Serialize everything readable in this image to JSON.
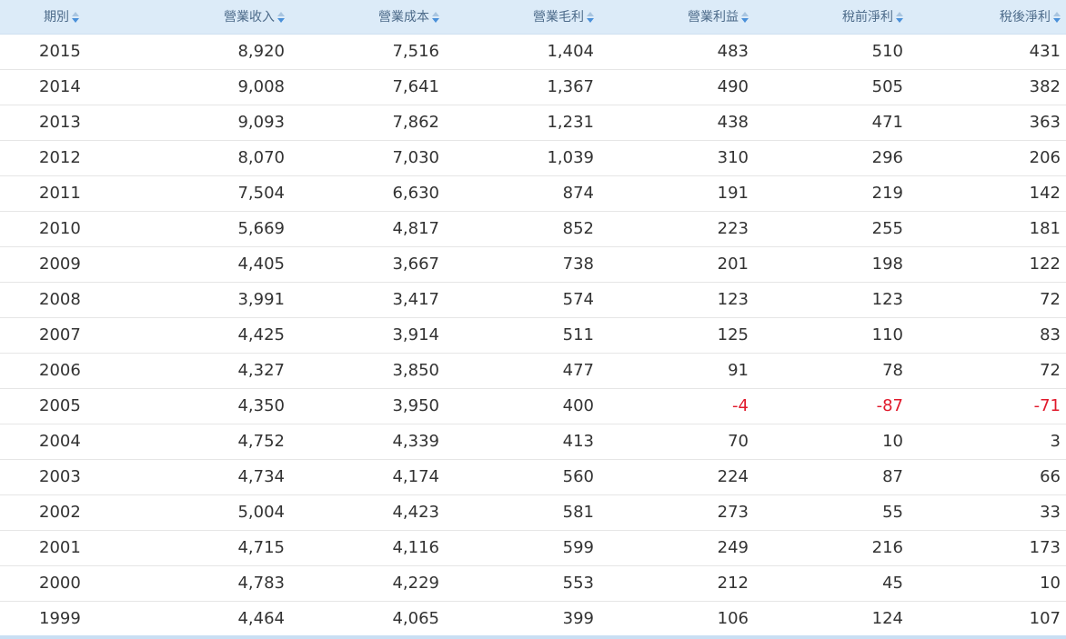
{
  "table": {
    "headers": [
      "期別",
      "營業收入",
      "營業成本",
      "營業毛利",
      "營業利益",
      "稅前淨利",
      "稅後淨利"
    ],
    "rows": [
      [
        "2015",
        "8,920",
        "7,516",
        "1,404",
        "483",
        "510",
        "431"
      ],
      [
        "2014",
        "9,008",
        "7,641",
        "1,367",
        "490",
        "505",
        "382"
      ],
      [
        "2013",
        "9,093",
        "7,862",
        "1,231",
        "438",
        "471",
        "363"
      ],
      [
        "2012",
        "8,070",
        "7,030",
        "1,039",
        "310",
        "296",
        "206"
      ],
      [
        "2011",
        "7,504",
        "6,630",
        "874",
        "191",
        "219",
        "142"
      ],
      [
        "2010",
        "5,669",
        "4,817",
        "852",
        "223",
        "255",
        "181"
      ],
      [
        "2009",
        "4,405",
        "3,667",
        "738",
        "201",
        "198",
        "122"
      ],
      [
        "2008",
        "3,991",
        "3,417",
        "574",
        "123",
        "123",
        "72"
      ],
      [
        "2007",
        "4,425",
        "3,914",
        "511",
        "125",
        "110",
        "83"
      ],
      [
        "2006",
        "4,327",
        "3,850",
        "477",
        "91",
        "78",
        "72"
      ],
      [
        "2005",
        "4,350",
        "3,950",
        "400",
        "-4",
        "-87",
        "-71"
      ],
      [
        "2004",
        "4,752",
        "4,339",
        "413",
        "70",
        "10",
        "3"
      ],
      [
        "2003",
        "4,734",
        "4,174",
        "560",
        "224",
        "87",
        "66"
      ],
      [
        "2002",
        "5,004",
        "4,423",
        "581",
        "273",
        "55",
        "33"
      ],
      [
        "2001",
        "4,715",
        "4,116",
        "599",
        "249",
        "216",
        "173"
      ],
      [
        "2000",
        "4,783",
        "4,229",
        "553",
        "212",
        "45",
        "10"
      ],
      [
        "1999",
        "4,464",
        "4,065",
        "399",
        "106",
        "124",
        "107"
      ]
    ]
  },
  "colors": {
    "header_bg": "#dcebf8",
    "header_text": "#4d6b8a",
    "cell_text": "#333333",
    "negative_text": "#e0192b",
    "sort_arrow_active": "#4a90d9"
  },
  "icons": {
    "sort": "sort-arrows-icon"
  }
}
